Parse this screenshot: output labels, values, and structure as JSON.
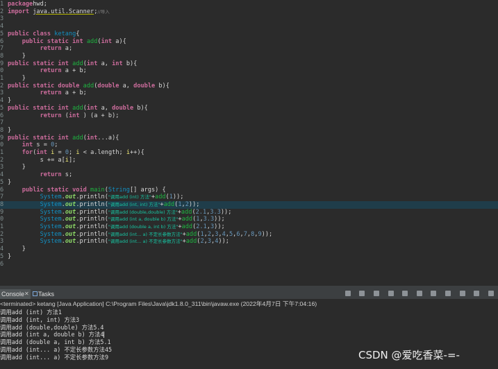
{
  "editor": {
    "lines": [
      {
        "n": "1",
        "hl": false,
        "tokens": [
          [
            "kw",
            "package"
          ],
          [
            "",
            "hwd;"
          ]
        ]
      },
      {
        "n": "2",
        "hl": false,
        "tokens": [
          [
            "kw",
            "import"
          ],
          [
            "",
            " "
          ],
          [
            "pkgname",
            "java.util.Scanner"
          ],
          [
            "",
            ";"
          ],
          [
            "cmt",
            "//导入"
          ]
        ]
      },
      {
        "n": "3",
        "hl": false,
        "tokens": []
      },
      {
        "n": "4",
        "hl": false,
        "tokens": []
      },
      {
        "n": "5",
        "hl": false,
        "tokens": [
          [
            "kw",
            "public class"
          ],
          [
            "",
            " "
          ],
          [
            "cls",
            "ketang"
          ],
          [
            "",
            "{"
          ]
        ]
      },
      {
        "n": "6",
        "hl": false,
        "tokens": [
          [
            "",
            "    "
          ],
          [
            "kw",
            "public static int"
          ],
          [
            "",
            " "
          ],
          [
            "fn",
            "add"
          ],
          [
            "",
            "("
          ],
          [
            "ty",
            "int"
          ],
          [
            "",
            " a){"
          ]
        ]
      },
      {
        "n": "7",
        "hl": false,
        "tokens": [
          [
            "",
            "         "
          ],
          [
            "kw",
            "return"
          ],
          [
            "",
            " a;"
          ]
        ]
      },
      {
        "n": "8",
        "hl": false,
        "tokens": [
          [
            "",
            "    }"
          ]
        ]
      },
      {
        "n": "9",
        "hl": false,
        "tokens": [
          [
            "kw",
            "public static int"
          ],
          [
            "",
            " "
          ],
          [
            "fn",
            "add"
          ],
          [
            "",
            "("
          ],
          [
            "ty",
            "int"
          ],
          [
            "",
            " a, "
          ],
          [
            "ty",
            "int"
          ],
          [
            "",
            " b){"
          ]
        ]
      },
      {
        "n": "0",
        "hl": false,
        "tokens": [
          [
            "",
            "         "
          ],
          [
            "kw",
            "return"
          ],
          [
            "",
            " a + b;"
          ]
        ]
      },
      {
        "n": "1",
        "hl": false,
        "tokens": [
          [
            "",
            "    }"
          ]
        ]
      },
      {
        "n": "2",
        "hl": false,
        "tokens": [
          [
            "kw",
            "public static double"
          ],
          [
            "",
            " "
          ],
          [
            "fn",
            "add"
          ],
          [
            "",
            "("
          ],
          [
            "ty",
            "double"
          ],
          [
            "",
            " a, "
          ],
          [
            "ty",
            "double"
          ],
          [
            "",
            " b){"
          ]
        ]
      },
      {
        "n": "3",
        "hl": false,
        "tokens": [
          [
            "",
            "         "
          ],
          [
            "kw",
            "return"
          ],
          [
            "",
            " a + b;"
          ]
        ]
      },
      {
        "n": "4",
        "hl": false,
        "tokens": [
          [
            "",
            "}"
          ]
        ]
      },
      {
        "n": "5",
        "hl": false,
        "tokens": [
          [
            "kw",
            "public static int"
          ],
          [
            "",
            " "
          ],
          [
            "fn",
            "add"
          ],
          [
            "",
            "("
          ],
          [
            "ty",
            "int"
          ],
          [
            "",
            " a, "
          ],
          [
            "ty",
            "double"
          ],
          [
            "",
            " b){"
          ]
        ]
      },
      {
        "n": "6",
        "hl": false,
        "tokens": [
          [
            "",
            "         "
          ],
          [
            "kw",
            "return"
          ],
          [
            "",
            " ("
          ],
          [
            "ty",
            "int"
          ],
          [
            "",
            " ) (a + b);"
          ]
        ]
      },
      {
        "n": "7",
        "hl": false,
        "tokens": []
      },
      {
        "n": "8",
        "hl": false,
        "tokens": [
          [
            "",
            "}"
          ]
        ]
      },
      {
        "n": "9",
        "hl": false,
        "tokens": [
          [
            "kw",
            "public static int"
          ],
          [
            "",
            " "
          ],
          [
            "fn",
            "add"
          ],
          [
            "",
            "("
          ],
          [
            "ty",
            "int"
          ],
          [
            "",
            "...a){"
          ]
        ]
      },
      {
        "n": "0",
        "hl": false,
        "tokens": [
          [
            "",
            "    "
          ],
          [
            "ty",
            "int"
          ],
          [
            "",
            " s = "
          ],
          [
            "num",
            "0"
          ],
          [
            "",
            ";"
          ]
        ]
      },
      {
        "n": "1",
        "hl": false,
        "tokens": [
          [
            "",
            "    "
          ],
          [
            "kw",
            "for"
          ],
          [
            "",
            "("
          ],
          [
            "ty",
            "int"
          ],
          [
            "",
            " "
          ],
          [
            "var",
            "i"
          ],
          [
            "",
            " = "
          ],
          [
            "num",
            "0"
          ],
          [
            "",
            "; "
          ],
          [
            "var",
            "i"
          ],
          [
            "",
            " < a.length; "
          ],
          [
            "var",
            "i"
          ],
          [
            "",
            "++){"
          ]
        ]
      },
      {
        "n": "2",
        "hl": false,
        "tokens": [
          [
            "",
            "         s += a["
          ],
          [
            "var",
            "i"
          ],
          [
            "",
            "];"
          ]
        ]
      },
      {
        "n": "3",
        "hl": false,
        "tokens": [
          [
            "",
            "    }"
          ]
        ]
      },
      {
        "n": "4",
        "hl": false,
        "tokens": [
          [
            "",
            "         "
          ],
          [
            "kw",
            "return"
          ],
          [
            "",
            " s;"
          ]
        ]
      },
      {
        "n": "5",
        "hl": false,
        "tokens": [
          [
            "",
            "}"
          ]
        ]
      },
      {
        "n": "6",
        "hl": false,
        "tokens": [
          [
            "",
            "    "
          ],
          [
            "kw",
            "public static void"
          ],
          [
            "",
            " "
          ],
          [
            "fn",
            "main"
          ],
          [
            "",
            "("
          ],
          [
            "cls",
            "String"
          ],
          [
            "",
            "[] args) {"
          ]
        ]
      },
      {
        "n": "7",
        "hl": false,
        "tokens": [
          [
            "",
            "         "
          ],
          [
            "cls",
            "System"
          ],
          [
            "",
            "."
          ],
          [
            "fld",
            "out"
          ],
          [
            "",
            ".println("
          ],
          [
            "str",
            "\"调用add (int) 方法\""
          ],
          [
            "",
            "+"
          ],
          [
            "fn",
            "add"
          ],
          [
            "",
            "("
          ],
          [
            "num",
            "1"
          ],
          [
            "",
            "));"
          ]
        ]
      },
      {
        "n": "8",
        "hl": true,
        "tokens": [
          [
            "",
            "         "
          ],
          [
            "cls",
            "System"
          ],
          [
            "",
            "."
          ],
          [
            "fld",
            "out"
          ],
          [
            "",
            ".println("
          ],
          [
            "str",
            "\"调用add (int, int) 方法\""
          ],
          [
            "",
            "+"
          ],
          [
            "fn",
            "add"
          ],
          [
            "",
            "("
          ],
          [
            "num",
            "1"
          ],
          [
            "",
            ","
          ],
          [
            "num",
            "2"
          ],
          [
            "",
            "));"
          ]
        ]
      },
      {
        "n": "9",
        "hl": false,
        "tokens": [
          [
            "",
            "         "
          ],
          [
            "cls",
            "System"
          ],
          [
            "",
            "."
          ],
          [
            "fld",
            "out"
          ],
          [
            "",
            ".println("
          ],
          [
            "str",
            "\"调用add (double,double) 方法\""
          ],
          [
            "",
            "+"
          ],
          [
            "fn",
            "add"
          ],
          [
            "",
            "("
          ],
          [
            "num",
            "2.1"
          ],
          [
            "",
            ","
          ],
          [
            "num",
            "3.3"
          ],
          [
            "",
            "));"
          ]
        ]
      },
      {
        "n": "0",
        "hl": false,
        "tokens": [
          [
            "",
            "         "
          ],
          [
            "cls",
            "System"
          ],
          [
            "",
            "."
          ],
          [
            "fld",
            "out"
          ],
          [
            "",
            ".println("
          ],
          [
            "str",
            "\"调用add (int a, double b) 方法\""
          ],
          [
            "",
            "+"
          ],
          [
            "fn",
            "add"
          ],
          [
            "",
            "("
          ],
          [
            "num",
            "1"
          ],
          [
            "",
            ","
          ],
          [
            "num",
            "3.3"
          ],
          [
            "",
            "));"
          ]
        ]
      },
      {
        "n": "1",
        "hl": false,
        "tokens": [
          [
            "",
            "         "
          ],
          [
            "cls",
            "System"
          ],
          [
            "",
            "."
          ],
          [
            "fld",
            "out"
          ],
          [
            "",
            ".println("
          ],
          [
            "str",
            "\"调用add (double a, int b) 方法\""
          ],
          [
            "",
            "+"
          ],
          [
            "fn",
            "add"
          ],
          [
            "",
            "("
          ],
          [
            "num",
            "2.1"
          ],
          [
            "",
            ","
          ],
          [
            "num",
            "3"
          ],
          [
            "",
            "));"
          ]
        ]
      },
      {
        "n": "2",
        "hl": false,
        "tokens": [
          [
            "",
            "         "
          ],
          [
            "cls",
            "System"
          ],
          [
            "",
            "."
          ],
          [
            "fld",
            "out"
          ],
          [
            "",
            ".println("
          ],
          [
            "str",
            "\"调用add (int... a) 不定长参数方法\""
          ],
          [
            "",
            "+"
          ],
          [
            "fn",
            "add"
          ],
          [
            "",
            "("
          ],
          [
            "num",
            "1"
          ],
          [
            "",
            ","
          ],
          [
            "num",
            "2"
          ],
          [
            "",
            ","
          ],
          [
            "num",
            "3"
          ],
          [
            "",
            ","
          ],
          [
            "num",
            "4"
          ],
          [
            "",
            ","
          ],
          [
            "num",
            "5"
          ],
          [
            "",
            ","
          ],
          [
            "num",
            "6"
          ],
          [
            "",
            ","
          ],
          [
            "num",
            "7"
          ],
          [
            "",
            ","
          ],
          [
            "num",
            "8"
          ],
          [
            "",
            ","
          ],
          [
            "num",
            "9"
          ],
          [
            "",
            "));"
          ]
        ]
      },
      {
        "n": "3",
        "hl": false,
        "tokens": [
          [
            "",
            "         "
          ],
          [
            "cls",
            "System"
          ],
          [
            "",
            "."
          ],
          [
            "fld",
            "out"
          ],
          [
            "",
            ".println("
          ],
          [
            "str",
            "\"调用add (int... a) 不定长参数方法\""
          ],
          [
            "",
            "+"
          ],
          [
            "fn",
            "add"
          ],
          [
            "",
            "("
          ],
          [
            "num",
            "2"
          ],
          [
            "",
            ","
          ],
          [
            "num",
            "3"
          ],
          [
            "",
            ","
          ],
          [
            "num",
            "4"
          ],
          [
            "",
            "));"
          ]
        ]
      },
      {
        "n": "4",
        "hl": false,
        "tokens": [
          [
            "",
            "    }"
          ]
        ]
      },
      {
        "n": "5",
        "hl": false,
        "tokens": [
          [
            "",
            "}"
          ]
        ]
      },
      {
        "n": "6",
        "hl": false,
        "tokens": []
      }
    ]
  },
  "console": {
    "tab_label": "Console",
    "tab_close": "✕",
    "tasks_label": "Tasks",
    "status": "<terminated> ketang [Java Application] C:\\Program Files\\Java\\jdk1.8.0_311\\bin\\javaw.exe (2022年4月7日 下午7:04:16)",
    "output": [
      "调用add (int) 方法1",
      "调用add (int, int) 方法3",
      "调用add (double,double) 方法5.4",
      "调用add (int a, double b) 方法4",
      "调用add (double a, int b) 方法5.1",
      "调用add (int... a) 不定长参数方法45",
      "调用add (int... a) 不定长参数方法9"
    ]
  },
  "watermark": "CSDN @爱吃香菜-=-",
  "colors": {
    "background": "#2b2b2b",
    "keyword": "#cc6c9c",
    "string": "#17c6a3",
    "method": "#1eb540",
    "class": "#1290c3",
    "highlight_line": "#1f3d4a"
  }
}
